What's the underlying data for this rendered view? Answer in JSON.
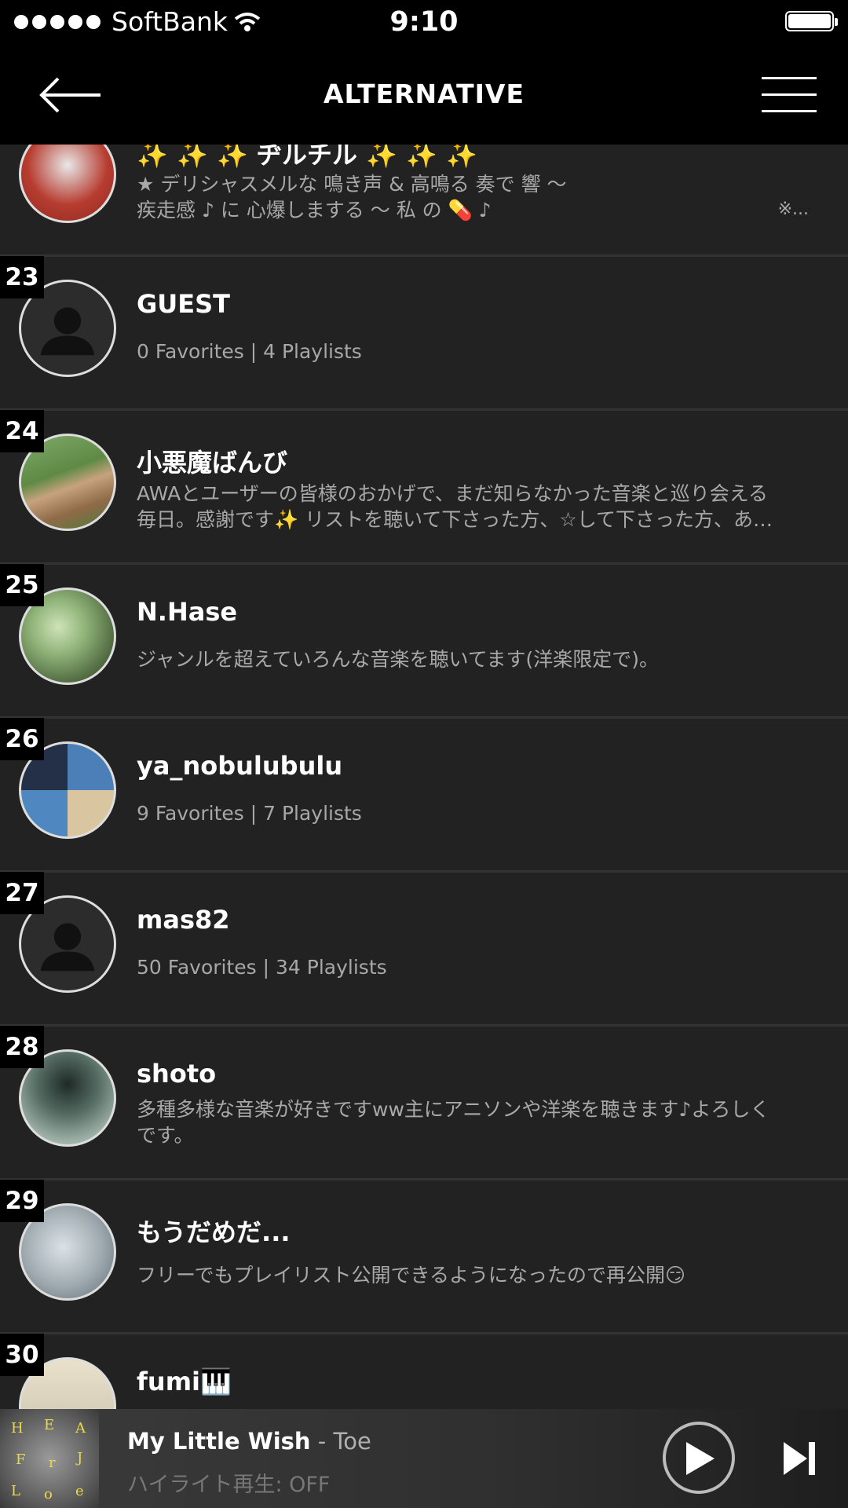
{
  "status_bar": {
    "carrier": "SoftBank",
    "time": "9:10"
  },
  "header": {
    "title": "ALTERNATIVE"
  },
  "users": [
    {
      "rank": "",
      "name": "✨ ✨ ✨ ヂルチル ✨ ✨ ✨",
      "desc_line1": "★ デリシャスメルな 鳴き声 &  高鳴る 奏で 響 〜",
      "desc_line2": "疾走感 ♪ に 心爆しまする 〜  私 の 💊 ♪",
      "desc_tail": "※...",
      "avatar": "anime"
    },
    {
      "rank": "23",
      "name": "GUEST",
      "desc": "0 Favorites | 4 Playlists",
      "avatar": "guest"
    },
    {
      "rank": "24",
      "name": "小悪魔ばんび",
      "desc_line1": "AWAとユーザーの皆様のおかげで、まだ知らなかった音楽と巡り会える",
      "desc_line2": "毎日。感謝です✨ リストを聴いて下さった方、☆して下さった方、あ…",
      "avatar": "deer"
    },
    {
      "rank": "25",
      "name": "N.Hase",
      "desc": "ジャンルを超えていろんな音楽を聴いてます(洋楽限定で)。",
      "avatar": "tree"
    },
    {
      "rank": "26",
      "name": "ya_nobulubulu",
      "desc": "9 Favorites | 7 Playlists",
      "avatar": "collage"
    },
    {
      "rank": "27",
      "name": "mas82",
      "desc": "50 Favorites | 34 Playlists",
      "avatar": "guest"
    },
    {
      "rank": "28",
      "name": "shoto",
      "desc_line1": "多種多様な音楽が好きですww主にアニソンや洋楽を聴きます♪よろしく",
      "desc_line2": "です。",
      "avatar": "cave"
    },
    {
      "rank": "29",
      "name": "もうだめだ...",
      "desc": "フリーでもプレイリスト公開できるようになったので再公開😏",
      "avatar": "dog"
    },
    {
      "rank": "30",
      "name": "fumi🎹",
      "desc": "",
      "avatar": "fumi"
    }
  ],
  "player": {
    "track": "My Little Wish",
    "separator": " - ",
    "artist": "Toe",
    "highlight": "ハイライト再生: OFF"
  }
}
